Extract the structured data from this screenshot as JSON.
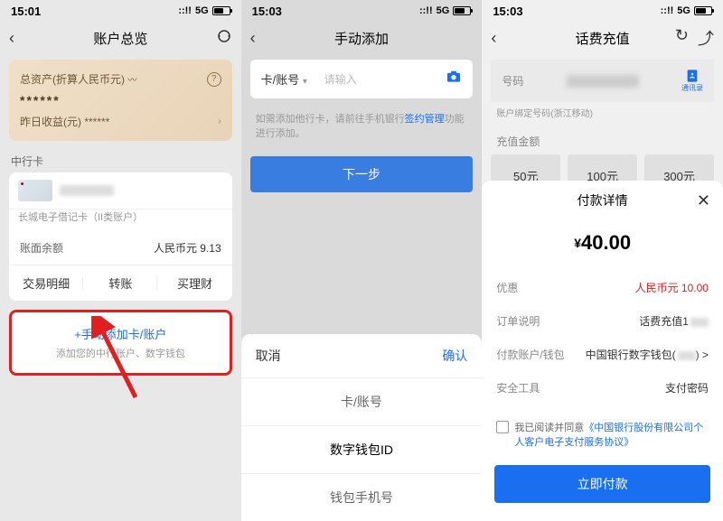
{
  "s1": {
    "time": "15:01",
    "network": "5G",
    "title": "账户总览",
    "asset_label": "总资产(折算人民币元)",
    "asset_val": "******",
    "yesterday": "昨日收益(元) ******",
    "section": "中行卡",
    "card_type": "长城电子借记卡（II类账户）",
    "balance_label": "账面余额",
    "currency": "人民币元",
    "balance": "9.13",
    "actions": [
      "交易明细",
      "转账",
      "买理财"
    ],
    "add_title": "+手动添加卡/账户",
    "add_sub": "添加您的中行账户、数字钱包"
  },
  "s2": {
    "time": "15:03",
    "network": "5G",
    "title": "手动添加",
    "field_label": "卡/账号",
    "placeholder": "请输入",
    "hint_pre": "如需添加他行卡，请前往手机银行",
    "hint_link": "签约管理",
    "hint_post": "功能进行添加。",
    "next": "下一步",
    "cancel": "取消",
    "confirm": "确认",
    "options": [
      "卡/账号",
      "数字钱包ID",
      "钱包手机号"
    ]
  },
  "s3": {
    "time": "15:03",
    "network": "5G",
    "title": "话费充值",
    "phone_label": "号码",
    "carrier": "通讯录",
    "bound": "账户绑定号码(浙江移动)",
    "amount_label": "充值金额",
    "amounts": [
      "50元",
      "100元",
      "300元"
    ],
    "pay_title": "付款详情",
    "pay_amount": "40.00",
    "discount_label": "优惠",
    "discount_val": "人民币元 10.00",
    "order_label": "订单说明",
    "order_val": "话费充值1",
    "account_label": "付款账户/钱包",
    "account_val": "中国银行数字钱包(",
    "account_suffix": ") >",
    "tool_label": "安全工具",
    "tool_val": "支付密码",
    "agree_pre": "我已阅读并同意",
    "agree_link": "《中国银行股份有限公司个人客户电子支付服务协议》",
    "pay_btn": "立即付款"
  }
}
